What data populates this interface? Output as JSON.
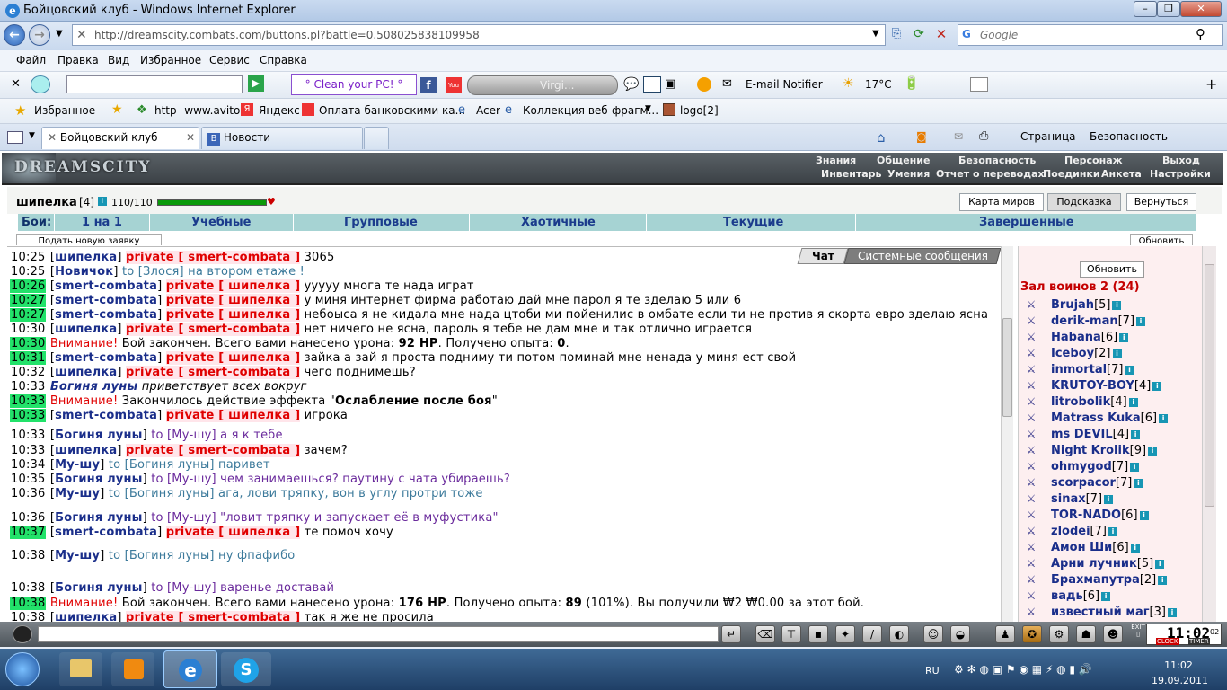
{
  "window": {
    "title": "Бойцовский клуб - Windows Internet Explorer"
  },
  "address": {
    "url": "http://dreamscity.combats.com/buttons.pl?battle=0.508025838109958",
    "search_placeholder": "Google"
  },
  "menu": [
    "Файл",
    "Правка",
    "Вид",
    "Избранное",
    "Сервис",
    "Справка"
  ],
  "toolbar": {
    "clean_pc": "° Clean your PC! °",
    "player": "Virgi...",
    "email": "E-mail Notifier",
    "temp": "17°C"
  },
  "favorites": {
    "label": "Избранное",
    "items": [
      "http--www.avito",
      "Яндекс",
      "Оплата банковскими ка...",
      "Acer",
      "Коллекция веб-фрагм...",
      "logo[2]"
    ]
  },
  "tabs": [
    {
      "label": "Бойцовский клуб"
    },
    {
      "label": "Новости"
    }
  ],
  "cmdbar": {
    "page": "Страница",
    "security": "Безопасность"
  },
  "site": {
    "logo": "DREAMSCITY",
    "nav1": [
      "Знания",
      "Общение",
      "Безопасность",
      "Персонаж",
      "Выход"
    ],
    "nav2": [
      "Инвентарь",
      "Умения",
      "Отчет о переводах",
      "Поединки",
      "Анкета",
      "Настройки"
    ]
  },
  "character": {
    "name": "шипелка",
    "level": "[4]",
    "hp": "110/110"
  },
  "top_buttons": [
    "Карта миров",
    "Подсказка",
    "Вернуться"
  ],
  "fight_tabs": [
    "Бои:",
    "1 на 1",
    "Учебные",
    "Групповые",
    "Хаотичные",
    "Текущие",
    "Завершенные"
  ],
  "sub": {
    "new_request": "Подать новую заявку",
    "refresh": "Обновить"
  },
  "chat_tabs": {
    "chat": "Чат",
    "system": "Системные сообщения"
  },
  "chat": [
    {
      "time": "10:25",
      "from": "шипелка",
      "type": "private",
      "to": "smert-combata",
      "text": "3065"
    },
    {
      "time": "10:25",
      "from": "Новичок",
      "type": "to",
      "to": "Злося",
      "text": "на втором етаже !"
    },
    {
      "time": "10:26",
      "hl": true,
      "from": "smert-combata",
      "type": "private",
      "to": "шипелка",
      "text": "ууууу многа те нада играт"
    },
    {
      "time": "10:27",
      "hl": true,
      "from": "smert-combata",
      "type": "private",
      "to": "шипелка",
      "text": "у миня интернет фирма работаю дай мне парол я те зделаю 5 или 6"
    },
    {
      "time": "10:27",
      "hl": true,
      "from": "smert-combata",
      "type": "private",
      "to": "шипелка",
      "text": "небоыса я не кидала мне нада цтоби ми пойенилис в омбате если ти не против я скорта евро зделаю ясна"
    },
    {
      "time": "10:30",
      "from": "шипелка",
      "type": "private",
      "to": "smert-combata",
      "text": "нет ничего не ясна, пароль я тебе не дам мне и так отлично играется"
    },
    {
      "time": "10:30",
      "hl": true,
      "type": "system",
      "prefix": "Внимание!",
      "text": "Бой закончен. Всего вами нанесено урона: ",
      "b1": "92 HP",
      "t2": ". Получено опыта: ",
      "b2": "0",
      "t3": "."
    },
    {
      "time": "10:31",
      "hl": true,
      "from": "smert-combata",
      "type": "private",
      "to": "шипелка",
      "text": "зайка а зай я проста подниму ти потом поминай мне ненада у миня ест свой"
    },
    {
      "time": "10:32",
      "from": "шипелка",
      "type": "private",
      "to": "smert-combata",
      "text": "чего поднимешь?"
    },
    {
      "time": "10:33",
      "type": "emote",
      "from": "Богиня луны",
      "text": "приветствует всех вокруг"
    },
    {
      "time": "10:33",
      "hl": true,
      "type": "system",
      "prefix": "Внимание!",
      "text": "Закончилось действие эффекта \"",
      "b1": "Ослабление после боя",
      "t2": "\"",
      "b2": "",
      "t3": ""
    },
    {
      "time": "10:33",
      "hl": true,
      "from": "smert-combata",
      "type": "private",
      "to": "шипелка",
      "text": "игрока"
    },
    {
      "time": "10:33",
      "from": "Богиня луны",
      "type": "to",
      "to": "Му-шу",
      "text": "а я к тебе"
    },
    {
      "time": "10:33",
      "from": "шипелка",
      "type": "private",
      "to": "smert-combata",
      "text": "зачем?"
    },
    {
      "time": "10:34",
      "from": "Му-шу",
      "type": "to",
      "to": "Богиня луны",
      "text": "паривет"
    },
    {
      "time": "10:35",
      "from": "Богиня луны",
      "type": "to",
      "to": "Му-шу",
      "text": "чем занимаешься? паутину с чата убираешь?"
    },
    {
      "time": "10:36",
      "from": "Му-шу",
      "type": "to",
      "to": "Богиня луны",
      "text": "ага, лови тряпку, вон в углу протри тоже"
    },
    {
      "time": "10:36",
      "from": "Богиня луны",
      "type": "to",
      "to": "Му-шу",
      "text": "\"ловит тряпку и запускает её в муфустика\""
    },
    {
      "time": "10:37",
      "hl": true,
      "from": "smert-combata",
      "type": "private",
      "to": "шипелка",
      "text": "те помоч хочу"
    },
    {
      "time": "10:38",
      "from": "Му-шу",
      "type": "to",
      "to": "Богиня луны",
      "text": "ну фпафибо"
    },
    {
      "time": "10:38",
      "from": "Богиня луны",
      "type": "to",
      "to": "Му-шу",
      "text": "варенье доставай"
    },
    {
      "time": "10:38",
      "hl": true,
      "type": "system",
      "prefix": "Внимание!",
      "text": "Бой закончен. Всего вами нанесено урона: ",
      "b1": "176 HP",
      "t2": ". Получено опыта: ",
      "b2": "89",
      "t3": " (101%). Вы получили ₩2 ₩0.00 за этот бой."
    },
    {
      "time": "10:38",
      "from": "шипелка",
      "type": "private",
      "to": "smert-combata",
      "text": "так я же не просила"
    }
  ],
  "warriors": {
    "refresh": "Обновить",
    "hall": "Зал воинов 2 (24)",
    "list": [
      {
        "name": "Brujah",
        "lv": "[5]"
      },
      {
        "name": "derik-man",
        "lv": "[7]"
      },
      {
        "name": "Habana",
        "lv": "[6]"
      },
      {
        "name": "Iceboy",
        "lv": "[2]"
      },
      {
        "name": "inmortal",
        "lv": "[7]"
      },
      {
        "name": "KRUTOY-BOY",
        "lv": "[4]"
      },
      {
        "name": "litrobolik",
        "lv": "[4]"
      },
      {
        "name": "Matrass Kuka",
        "lv": "[6]"
      },
      {
        "name": "ms DEVIL",
        "lv": "[4]"
      },
      {
        "name": "Night Krolik",
        "lv": "[9]"
      },
      {
        "name": "ohmygod",
        "lv": "[7]"
      },
      {
        "name": "scorpacor",
        "lv": "[7]"
      },
      {
        "name": "sinax",
        "lv": "[7]"
      },
      {
        "name": "TOR-NADO",
        "lv": "[6]"
      },
      {
        "name": "zlodei",
        "lv": "[7]"
      },
      {
        "name": "Амон Ши",
        "lv": "[6]"
      },
      {
        "name": "Арни лучник",
        "lv": "[5]"
      },
      {
        "name": "Брахмапутра",
        "lv": "[2]"
      },
      {
        "name": "вадь",
        "lv": "[6]"
      },
      {
        "name": "известный маг",
        "lv": "[3]"
      }
    ]
  },
  "timer": {
    "time": "11:02",
    "sec": "02",
    "clock": "CLOCK",
    "timer": "TIMER",
    "exit": "EXIT"
  },
  "taskbar": {
    "lang": "RU",
    "time": "11:02",
    "date": "19.09.2011"
  },
  "colors": {
    "green_highlight": "#22e26a",
    "private": "#e00000",
    "nick": "#1a2e8a",
    "fight_tab_bg": "#a6d3d3"
  }
}
